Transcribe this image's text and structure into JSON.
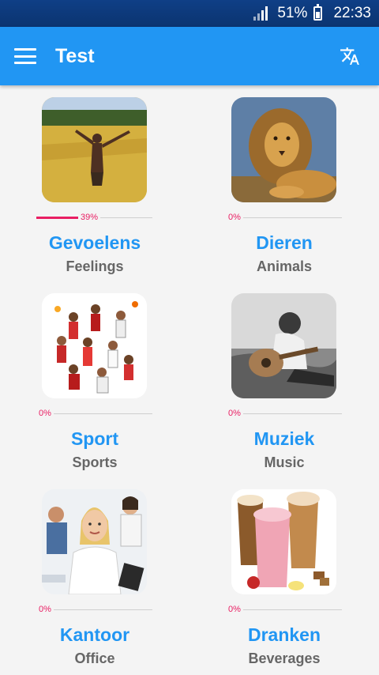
{
  "status_bar": {
    "battery": "51%",
    "time": "22:33"
  },
  "app_bar": {
    "title": "Test",
    "menu_icon": "hamburger-menu-icon",
    "translate_icon": "translate-icon"
  },
  "accent_colors": {
    "primary": "#2196f3",
    "progress": "#e91e63",
    "status_bar": "#0d3a7a"
  },
  "categories": [
    {
      "title": "Gevoelens",
      "subtitle": "Feelings",
      "progress": 0.39,
      "progress_label": "39%",
      "image": "woman-in-field-image"
    },
    {
      "title": "Dieren",
      "subtitle": "Animals",
      "progress": 0,
      "progress_label": "0%",
      "image": "lion-image"
    },
    {
      "title": "Sport",
      "subtitle": "Sports",
      "progress": 0,
      "progress_label": "0%",
      "image": "athletes-collage-image"
    },
    {
      "title": "Muziek",
      "subtitle": "Music",
      "progress": 0,
      "progress_label": "0%",
      "image": "guitar-player-image"
    },
    {
      "title": "Kantoor",
      "subtitle": "Office",
      "progress": 0,
      "progress_label": "0%",
      "image": "office-workers-image"
    },
    {
      "title": "Dranken",
      "subtitle": "Beverages",
      "progress": 0,
      "progress_label": "0%",
      "image": "drinks-image"
    }
  ]
}
